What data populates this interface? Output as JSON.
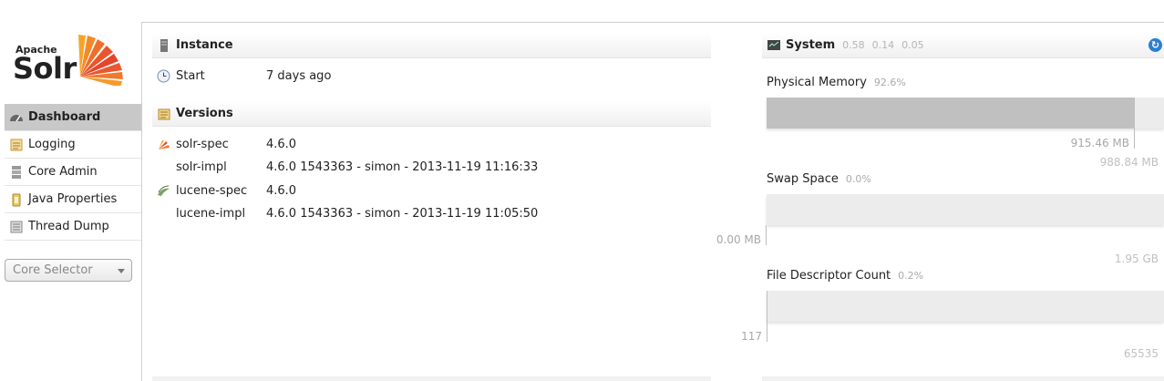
{
  "logo": {
    "brand": "Apache",
    "product": "Solr"
  },
  "sidebar": {
    "items": [
      {
        "label": "Dashboard",
        "icon": "dashboard-icon",
        "active": true
      },
      {
        "label": "Logging",
        "icon": "logging-icon"
      },
      {
        "label": "Core Admin",
        "icon": "core-admin-icon"
      },
      {
        "label": "Java Properties",
        "icon": "java-properties-icon"
      },
      {
        "label": "Thread Dump",
        "icon": "thread-dump-icon"
      }
    ],
    "core_selector": {
      "placeholder": "Core Selector"
    }
  },
  "instance": {
    "title": "Instance",
    "start_label": "Start",
    "start_value": "7 days ago"
  },
  "versions": {
    "title": "Versions",
    "rows": [
      {
        "key": "solr-spec",
        "value": "4.6.0",
        "icon": "solr-icon"
      },
      {
        "key": "solr-impl",
        "value": "4.6.0 1543363 - simon - 2013-11-19 11:16:33"
      },
      {
        "key": "lucene-spec",
        "value": "4.6.0",
        "icon": "lucene-icon"
      },
      {
        "key": "lucene-impl",
        "value": "4.6.0 1543363 - simon - 2013-11-19 11:05:50"
      }
    ]
  },
  "system": {
    "title": "System",
    "load": [
      "0.58",
      "0.14",
      "0.05"
    ],
    "bars": [
      {
        "label": "Physical Memory",
        "percent_text": "92.6%",
        "fraction": 0.926,
        "used": "915.46 MB",
        "max": "988.84 MB"
      },
      {
        "label": "Swap Space",
        "percent_text": "0.0%",
        "fraction": 0.0,
        "used": "0.00 MB",
        "max": "1.95 GB"
      },
      {
        "label": "File Descriptor Count",
        "percent_text": "0.2%",
        "fraction": 0.002,
        "used": "117",
        "max": "65535"
      }
    ]
  },
  "colors": {
    "refresh": "#2a7fd0",
    "active_nav": "#c8c8c8",
    "bar_fill": "#c0c0c0",
    "bar_track": "#ececec"
  }
}
